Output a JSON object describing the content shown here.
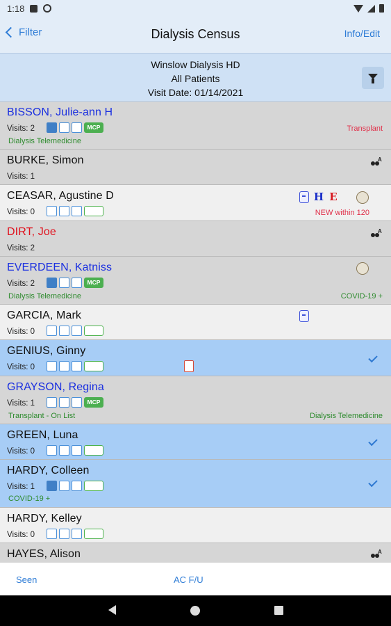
{
  "status_bar": {
    "time": "1:18"
  },
  "nav": {
    "back_label": "Filter",
    "title": "Dialysis Census",
    "right_label": "Info/Edit"
  },
  "header": {
    "line1": "Winslow Dialysis HD",
    "line2": "All Patients",
    "line3": "Visit Date: 01/14/2021"
  },
  "patients": [
    {
      "name": "BISSON, Julie-ann H",
      "visits": "Visits: 2",
      "tag": "MCP",
      "sub_left": "Dialysis Telemedicine",
      "sub_right": "Transplant"
    },
    {
      "name": "BURKE, Simon",
      "visits": "Visits: 1"
    },
    {
      "name": "CEASAR, Agustine D",
      "visits": "Visits: 0",
      "icon_h": "H",
      "icon_e": "E",
      "sub_right": "NEW within 120"
    },
    {
      "name": "DIRT, Joe",
      "visits": "Visits: 2"
    },
    {
      "name": "EVERDEEN, Katniss",
      "visits": "Visits: 2",
      "tag": "MCP",
      "sub_left": "Dialysis Telemedicine",
      "sub_right": "COVID-19 +"
    },
    {
      "name": "GARCIA, Mark",
      "visits": "Visits: 0"
    },
    {
      "name": "GENIUS, Ginny",
      "visits": "Visits: 0"
    },
    {
      "name": "GRAYSON, Regina",
      "visits": "Visits: 1",
      "tag": "MCP",
      "sub_left": "Transplant - On List",
      "sub_right": "Dialysis Telemedicine"
    },
    {
      "name": "GREEN, Luna",
      "visits": "Visits: 0"
    },
    {
      "name": "HARDY, Colleen",
      "visits": "Visits: 1",
      "sub_left": "COVID-19 +"
    },
    {
      "name": "HARDY, Kelley",
      "visits": "Visits: 0"
    },
    {
      "name": "HAYES, Alison"
    }
  ],
  "tabs": {
    "seen": "Seen",
    "ac_fu": "AC F/U"
  },
  "colors": {
    "accent": "#2e7cd6",
    "selected_row": "#a7cdf6",
    "name_blue": "#1a2fe0",
    "name_red": "#e0101c",
    "tag_green": "#4caf50"
  }
}
